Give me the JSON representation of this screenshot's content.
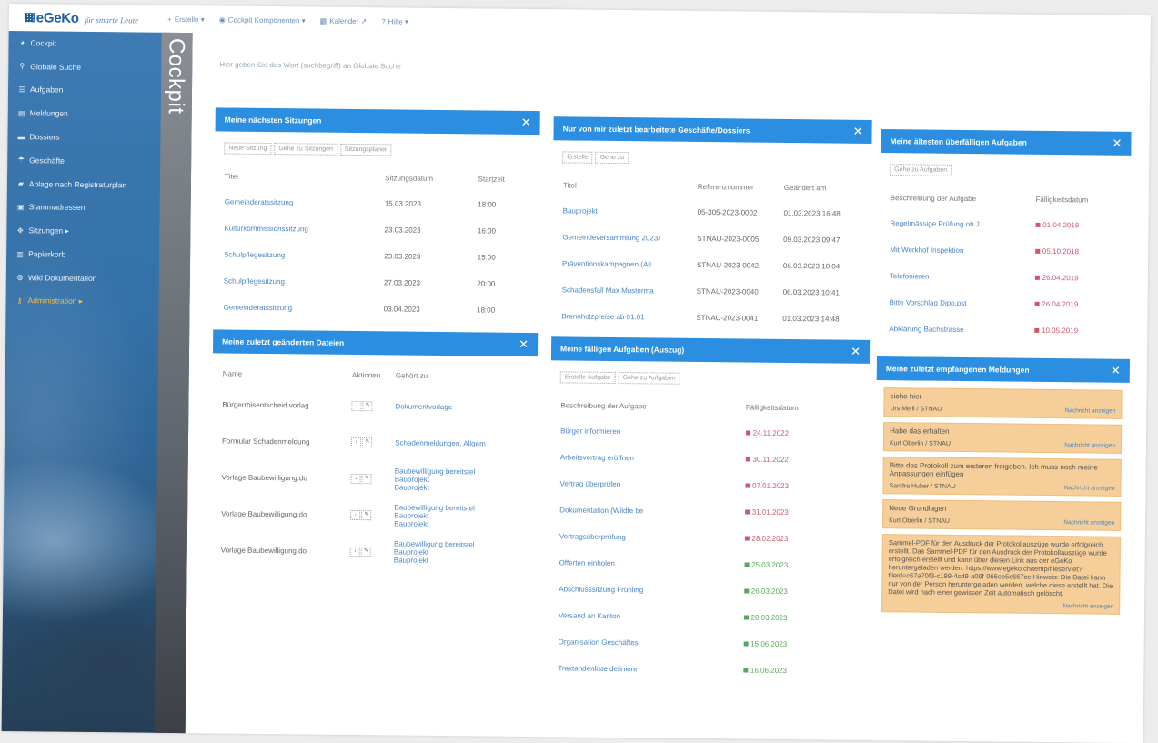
{
  "app": {
    "logo": "eGeKo",
    "slogan": "für smarte Leute",
    "nav": [
      "Erstelle ▾",
      "Cockpit Komponenten ▾",
      "Kalender ↗",
      "Hilfe ▾"
    ]
  },
  "sidebar": {
    "title": "Cockpit",
    "items": [
      {
        "label": "Cockpit",
        "icon": "gauge-icon"
      },
      {
        "label": "Globale Suche",
        "icon": "search-icon"
      },
      {
        "label": "Aufgaben",
        "icon": "tasks-icon"
      },
      {
        "label": "Meldungen",
        "icon": "messages-icon"
      },
      {
        "label": "Dossiers",
        "icon": "dossier-icon"
      },
      {
        "label": "Geschäfte",
        "icon": "business-icon"
      },
      {
        "label": "Ablage nach Registraturplan",
        "icon": "folder-icon"
      },
      {
        "label": "Stammadressen",
        "icon": "address-icon"
      },
      {
        "label": "Sitzungen ▸",
        "icon": "meeting-icon"
      },
      {
        "label": "Papierkorb",
        "icon": "trash-icon"
      },
      {
        "label": "Wiki Dokumentation",
        "icon": "wiki-icon"
      },
      {
        "label": "Administration ▸",
        "icon": "keys-icon"
      }
    ]
  },
  "intro": "Hier geben Sie das Wort (suchbegriff) an Globale Suche",
  "sessions": {
    "title": "Meine nächsten Sitzungen",
    "buttons": [
      "Neue Sitzung",
      "Gehe zu Sitzungen",
      "Sitzungsplaner"
    ],
    "columns": [
      "Titel",
      "Sitzungsdatum",
      "Startzeit"
    ],
    "rows": [
      [
        "Gemeinderatssitzung",
        "15.03.2023",
        "18:00"
      ],
      [
        "Kulturkommissionssitzung",
        "23.03.2023",
        "16:00"
      ],
      [
        "Schulpflegesitzung",
        "23.03.2023",
        "15:00"
      ],
      [
        "Schulpflegesitzung",
        "27.03.2023",
        "20:00"
      ],
      [
        "Gemeinderatssitzung",
        "03.04.2023",
        "18:00"
      ]
    ]
  },
  "dossiers": {
    "title": "Nur von mir zuletzt bearbeitete Geschäfte/Dossiers",
    "buttons": [
      "Erstelle",
      "Gehe zu"
    ],
    "columns": [
      "Titel",
      "Referenznummer",
      "Geändert am"
    ],
    "rows": [
      [
        "Bauprojekt",
        "05-305-2023-0002",
        "01.03.2023 16:48"
      ],
      [
        "Gemeindeversammlung 2023/",
        "STNAU-2023-0005",
        "09.03.2023 09:47"
      ],
      [
        "Präventionskampagnen (All",
        "STNAU-2023-0042",
        "06.03.2023 10:04"
      ],
      [
        "Schadensfall Max Musterma",
        "STNAU-2023-0040",
        "06.03.2023 10:41"
      ],
      [
        "Brennholzpreise ab 01.01",
        "STNAU-2023-0041",
        "01.03.2023 14:48"
      ]
    ]
  },
  "overdue": {
    "title": "Meine ältesten überfälligen Aufgaben",
    "buttons": [
      "Gehe zu Aufgaben"
    ],
    "columns": [
      "Beschreibung der Aufgabe",
      "Fälligkeitsdatum"
    ],
    "rows": [
      [
        "Regelmässige Prüfung ob J",
        "01.04.2018"
      ],
      [
        "Mit Werkhof Inspektion",
        "05.10.2018"
      ],
      [
        "Telefonieren",
        "26.04.2019"
      ],
      [
        "Bitte Vorschlag Dipp.pst",
        "26.04.2019"
      ],
      [
        "Abklärung Bachstrasse",
        "10.05.2019"
      ]
    ]
  },
  "files": {
    "title": "Meine zuletzt geänderten Dateien",
    "columns": [
      "Name",
      "Aktionen",
      "Gehört zu"
    ],
    "rows": [
      {
        "name": "Bürgerrbisentscheid.vorlag",
        "gehoert": [
          "Dokumentvorlage"
        ]
      },
      {
        "name": "Formular Schadenmeldung",
        "gehoert": [
          "Schadenmeldungen, Allgem"
        ]
      },
      {
        "name": "Vorlage Baubewilligung.do",
        "gehoert": [
          "Baubewilligung bereitstel",
          "Bauprojekt",
          "Bauprojekt"
        ]
      },
      {
        "name": "Vorlage Baubewilligung.do",
        "gehoert": [
          "Baubewilligung bereitstel",
          "Bauprojekt",
          "Bauprojekt"
        ]
      },
      {
        "name": "Vorlage Baubewilligung.do",
        "gehoert": [
          "Baubewilligung bereitstel",
          "Bauprojekt",
          "Bauprojekt"
        ]
      }
    ]
  },
  "duetasks": {
    "title": "Meine fälligen Aufgaben (Auszug)",
    "buttons": [
      "Erstelle Aufgabe",
      "Gehe zu Aufgaben"
    ],
    "columns": [
      "Beschreibung der Aufgabe",
      "Fälligkeitsdatum"
    ],
    "rows": [
      {
        "desc": "Bürger informieren",
        "date": "24.11.2022",
        "status": "red"
      },
      {
        "desc": "Arbeitsvertrag eröffnen",
        "date": "30.11.2022",
        "status": "red"
      },
      {
        "desc": "Vertrag überprüfen",
        "date": "07.01.2023",
        "status": "red"
      },
      {
        "desc": "Dokumentation (Wildfe be",
        "date": "31.01.2023",
        "status": "red"
      },
      {
        "desc": "Vertragsüberprüfung",
        "date": "28.02.2023",
        "status": "red"
      },
      {
        "desc": "Offerten einholen",
        "date": "25.03.2023",
        "status": "green"
      },
      {
        "desc": "Abschlusssitzung Frühling",
        "date": "26.03.2023",
        "status": "green"
      },
      {
        "desc": "Versand an Kanton",
        "date": "28.03.2023",
        "status": "green"
      },
      {
        "desc": "Organisation Geschäftes",
        "date": "15.06.2023",
        "status": "green"
      },
      {
        "desc": "Traktandenliste definiere",
        "date": "16.06.2023",
        "status": "green"
      }
    ]
  },
  "messages": {
    "title": "Meine zuletzt empfangenen Meldungen",
    "link_label": "Nachricht anzeigen",
    "items": [
      {
        "text": "siehe hier",
        "from": "Urs Meili / STNAU"
      },
      {
        "text": "Habe das erhalten",
        "from": "Kurt Oberlin / STNAU"
      },
      {
        "text": "Bitte das Protokoll zum ersteren freigeben. Ich muss noch meine Anpassungen einfügen",
        "from": "Sandra Huber / STNAU"
      },
      {
        "text": "Neue Grundlagen",
        "from": "Kurt Oberlin / STNAU"
      },
      {
        "text": "Sammel-PDF für den Ausdruck der Protokollauszüge wurde erfolgreich erstellt. Das Sammel-PDF für den Ausdruck der Protokollauszüge wurde erfolgreich erstellt und kann über diesen Link aus der eGeKo heruntergeladen werden: https://www.egeko.ch/temp/fileserviet?fileid=c67a70f3-c199-4cd9-a09f-066eb5c667ce Hinweis: Die Datei kann nur von der Person heruntergeladen werden, welche diese erstellt hat. Die Datei wird nach einer gewissen Zeit automatisch gelöscht.",
        "from": ""
      }
    ]
  },
  "colors": {
    "accent": "#2b8ee0",
    "overdue": "#d0576a",
    "ontime": "#5aa65a",
    "message_bg": "#f5ce9a"
  }
}
